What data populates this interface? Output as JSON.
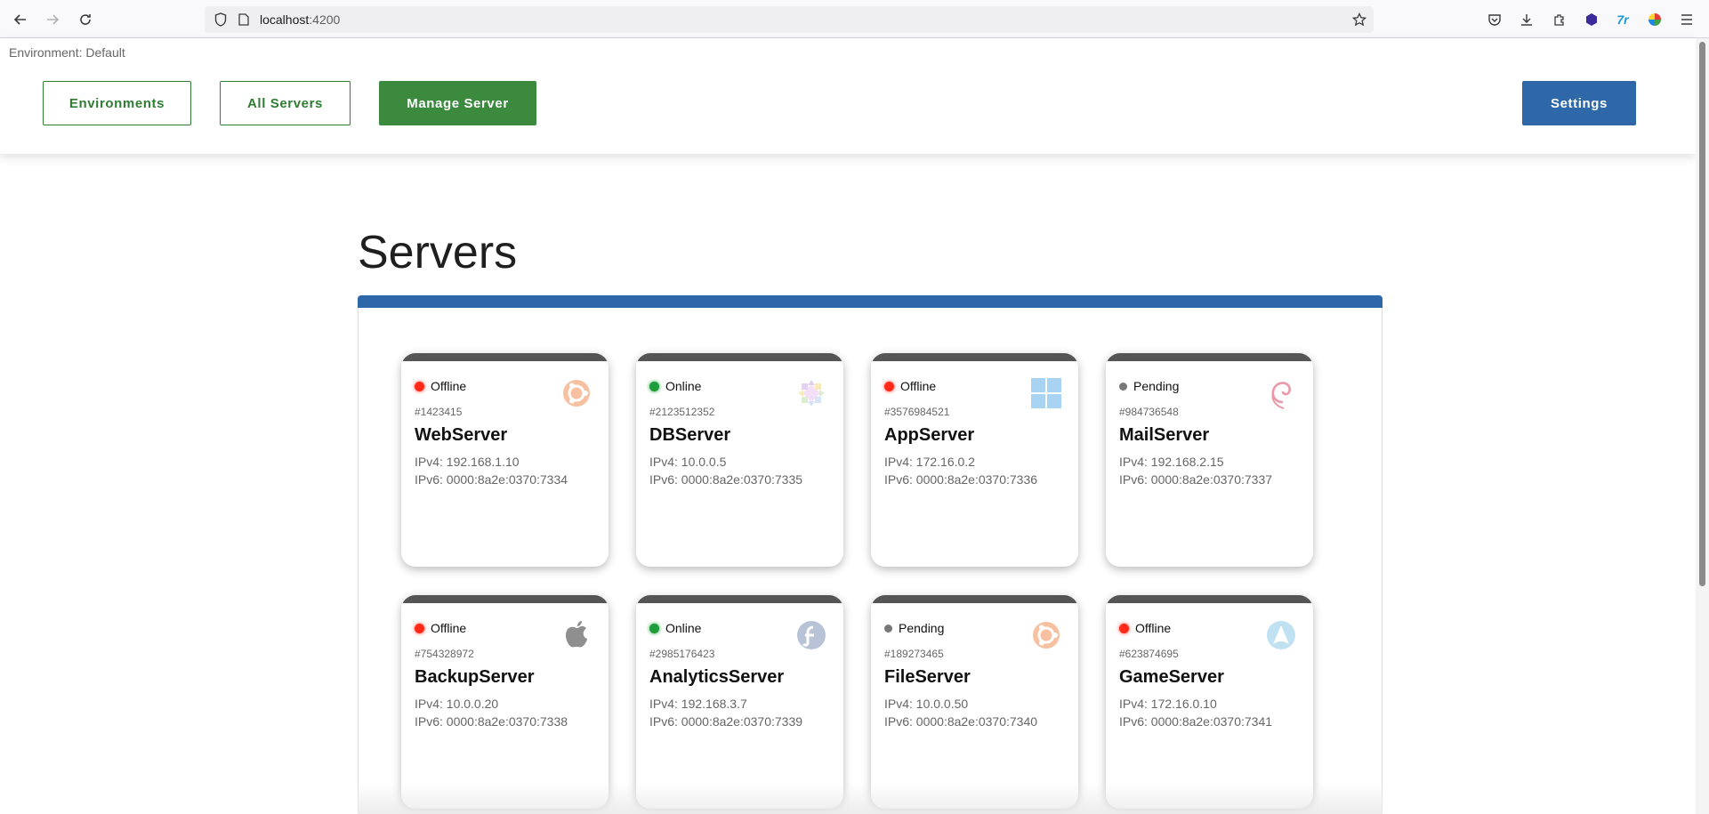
{
  "browser": {
    "url_host": "localhost",
    "url_port": ":4200"
  },
  "header": {
    "environment_label": "Environment: Default",
    "buttons": {
      "environments": "Environments",
      "all_servers": "All Servers",
      "manage_server": "Manage Server",
      "settings": "Settings"
    }
  },
  "main": {
    "title": "Servers"
  },
  "colors": {
    "primary_blue": "#2f68a8",
    "primary_green": "#3b8a3e",
    "status_offline": "#ff2a1a",
    "status_online": "#1f9d3a",
    "status_pending": "#777777"
  },
  "servers": [
    {
      "status": "Offline",
      "id": "#1423415",
      "name": "WebServer",
      "ipv4": "IPv4: 192.168.1.10",
      "ipv6": "IPv6: 0000:8a2e:0370:7334",
      "os_icon": "ubuntu-icon"
    },
    {
      "status": "Online",
      "id": "#2123512352",
      "name": "DBServer",
      "ipv4": "IPv4: 10.0.0.5",
      "ipv6": "IPv6: 0000:8a2e:0370:7335",
      "os_icon": "centos-icon"
    },
    {
      "status": "Offline",
      "id": "#3576984521",
      "name": "AppServer",
      "ipv4": "IPv4: 172.16.0.2",
      "ipv6": "IPv6: 0000:8a2e:0370:7336",
      "os_icon": "windows-icon"
    },
    {
      "status": "Pending",
      "id": "#984736548",
      "name": "MailServer",
      "ipv4": "IPv4: 192.168.2.15",
      "ipv6": "IPv6: 0000:8a2e:0370:7337",
      "os_icon": "debian-icon"
    },
    {
      "status": "Offline",
      "id": "#754328972",
      "name": "BackupServer",
      "ipv4": "IPv4: 10.0.0.20",
      "ipv6": "IPv6: 0000:8a2e:0370:7338",
      "os_icon": "apple-icon"
    },
    {
      "status": "Online",
      "id": "#2985176423",
      "name": "AnalyticsServer",
      "ipv4": "IPv4: 192.168.3.7",
      "ipv6": "IPv6: 0000:8a2e:0370:7339",
      "os_icon": "fedora-icon"
    },
    {
      "status": "Pending",
      "id": "#189273465",
      "name": "FileServer",
      "ipv4": "IPv4: 10.0.0.50",
      "ipv6": "IPv6: 0000:8a2e:0370:7340",
      "os_icon": "ubuntu-icon"
    },
    {
      "status": "Offline",
      "id": "#623874695",
      "name": "GameServer",
      "ipv4": "IPv4: 172.16.0.10",
      "ipv6": "IPv6: 0000:8a2e:0370:7341",
      "os_icon": "arch-icon"
    }
  ]
}
